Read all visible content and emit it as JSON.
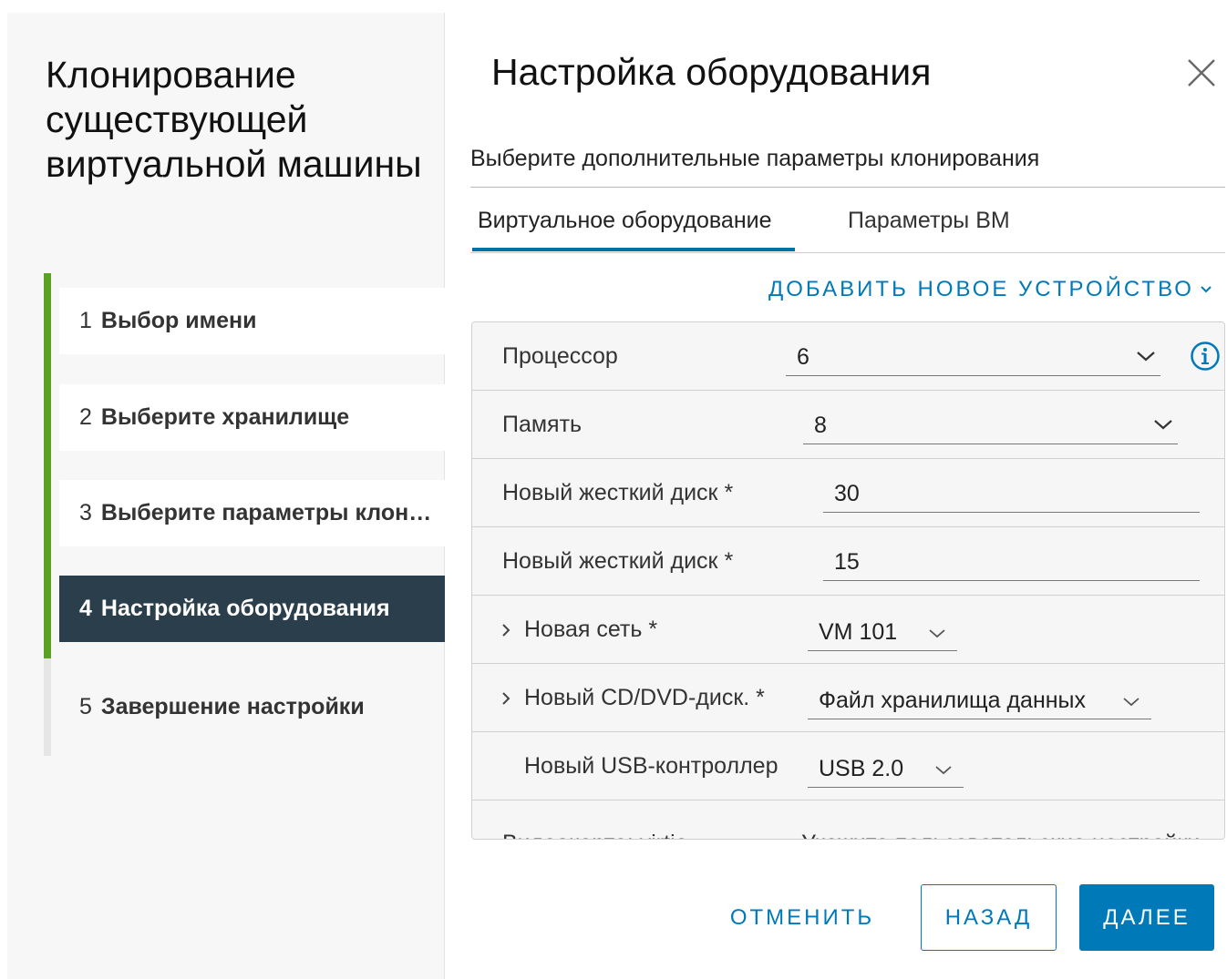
{
  "wizard": {
    "title": "Клонирование существующей виртуальной машины",
    "steps": [
      {
        "number": "1",
        "label": "Выбор имени",
        "state": "completed"
      },
      {
        "number": "2",
        "label": "Выберите хранилище",
        "state": "completed"
      },
      {
        "number": "3",
        "label": "Выберите параметры клонирования",
        "state": "completed"
      },
      {
        "number": "4",
        "label": "Настройка оборудования",
        "state": "active"
      },
      {
        "number": "5",
        "label": "Завершение настройки",
        "state": "pending"
      }
    ]
  },
  "content": {
    "title": "Настройка оборудования",
    "subtitle": "Выберите дополнительные параметры клонирования",
    "tabs": [
      {
        "label": "Виртуальное оборудование",
        "active": true
      },
      {
        "label": "Параметры ВМ",
        "active": false
      }
    ],
    "add_device_label": "ДОБАВИТЬ НОВОЕ УСТРОЙСТВО",
    "hardware": {
      "cpu": {
        "label": "Процессор",
        "value": "6"
      },
      "memory": {
        "label": "Память",
        "value": "8"
      },
      "disk1": {
        "label": "Новый жесткий диск *",
        "value": "30"
      },
      "disk2": {
        "label": "Новый жесткий диск *",
        "value": "15"
      },
      "network": {
        "label": "Новая сеть *",
        "value": "VM 101"
      },
      "cdrom": {
        "label": "Новый CD/DVD-диск. *",
        "value": "Файл хранилища данных"
      },
      "usb": {
        "label": "Новый USB-контроллер",
        "value": "USB 2.0"
      },
      "video": {
        "label": "Видеокарта: virtio",
        "value": "Укажите пользовательские настройки"
      }
    }
  },
  "footer": {
    "cancel_label": "ОТМЕНИТЬ",
    "back_label": "НАЗАД",
    "next_label": "ДАЛЕЕ"
  },
  "colors": {
    "accent": "#0079b8",
    "progress": "#5aa220",
    "active_step_bg": "#2b3e4c"
  },
  "icons": {
    "close": "close-icon",
    "chevron": "chevron-down-icon",
    "expand": "chevron-right-icon",
    "info": "info-icon"
  }
}
